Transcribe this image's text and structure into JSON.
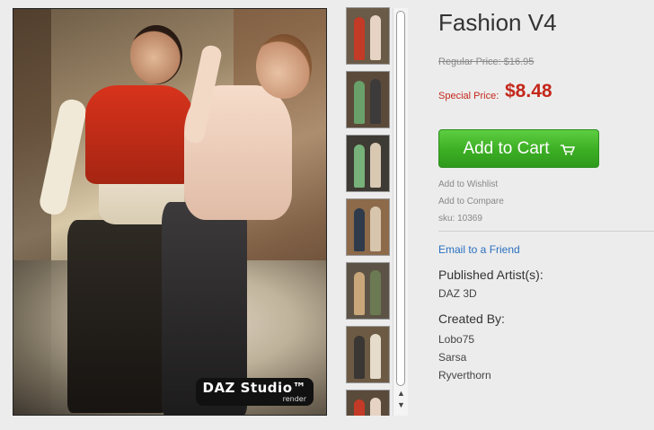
{
  "product": {
    "title": "Fashion V4",
    "regular_price_label": "Regular Price: $16.95",
    "special_price_label": "Special Price:",
    "special_price": "$8.48",
    "add_to_cart_label": "Add to Cart",
    "add_to_wishlist": "Add to Wishlist",
    "add_to_compare": "Add to Compare",
    "sku": "sku: 10369",
    "email_friend": "Email to a Friend",
    "published_heading": "Published Artist(s):",
    "published_artists": [
      "DAZ 3D"
    ],
    "created_heading": "Created By:",
    "creators": [
      "Lobo75",
      "Sarsa",
      "Ryverthorn"
    ]
  },
  "image": {
    "watermark_line1": "DAZ Studio™",
    "watermark_line2": "render"
  },
  "thumbnails": [
    {
      "bg": "#6a5a48",
      "a": "#c33a26",
      "b": "#e7d3c3"
    },
    {
      "bg": "#5b4a3a",
      "a": "#6aa06a",
      "b": "#3c3a3a"
    },
    {
      "bg": "#3e3a34",
      "a": "#76b27a",
      "b": "#d9c8b2"
    },
    {
      "bg": "#8c6a4a",
      "a": "#2f3a4a",
      "b": "#d7c6ad"
    },
    {
      "bg": "#5c5346",
      "a": "#c9a77b",
      "b": "#6b7a52"
    },
    {
      "bg": "#6d5a44",
      "a": "#3a3633",
      "b": "#e6dccb"
    },
    {
      "bg": "#5a4a3a",
      "a": "#c33a26",
      "b": "#e7d3c3"
    }
  ],
  "colors": {
    "accent_red": "#c4271b",
    "cart_green": "#3cae24",
    "link_blue": "#2a6fc0"
  },
  "icons": {
    "cart": "shopping-cart-icon",
    "scroll_up": "scroll-up-arrow",
    "scroll_down": "scroll-down-arrow"
  }
}
